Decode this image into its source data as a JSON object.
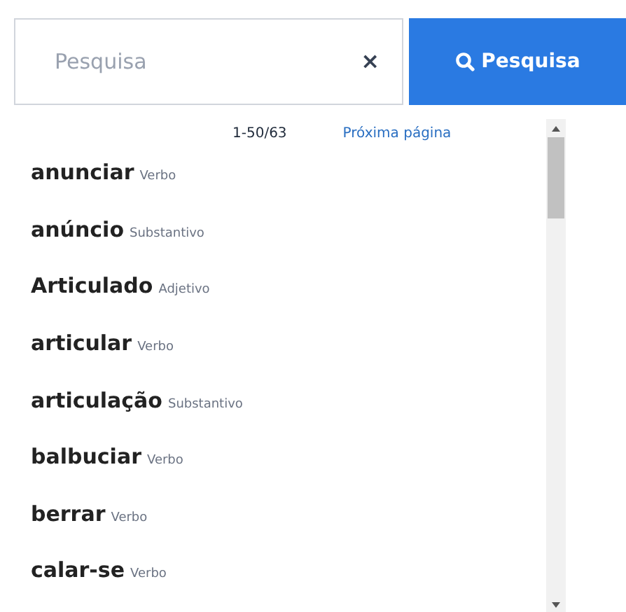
{
  "search": {
    "placeholder": "Pesquisa",
    "clear": "×",
    "button": "Pesquisa"
  },
  "pager": {
    "range": "1-50/63",
    "next": "Próxima página"
  },
  "results": [
    {
      "word": "anunciar",
      "class": "Verbo"
    },
    {
      "word": "anúncio",
      "class": "Substantivo"
    },
    {
      "word": "Articulado",
      "class": "Adjetivo"
    },
    {
      "word": "articular",
      "class": "Verbo"
    },
    {
      "word": "articulação",
      "class": "Substantivo"
    },
    {
      "word": "balbuciar",
      "class": "Verbo"
    },
    {
      "word": "berrar",
      "class": "Verbo"
    },
    {
      "word": "calar-se",
      "class": "Verbo"
    }
  ]
}
